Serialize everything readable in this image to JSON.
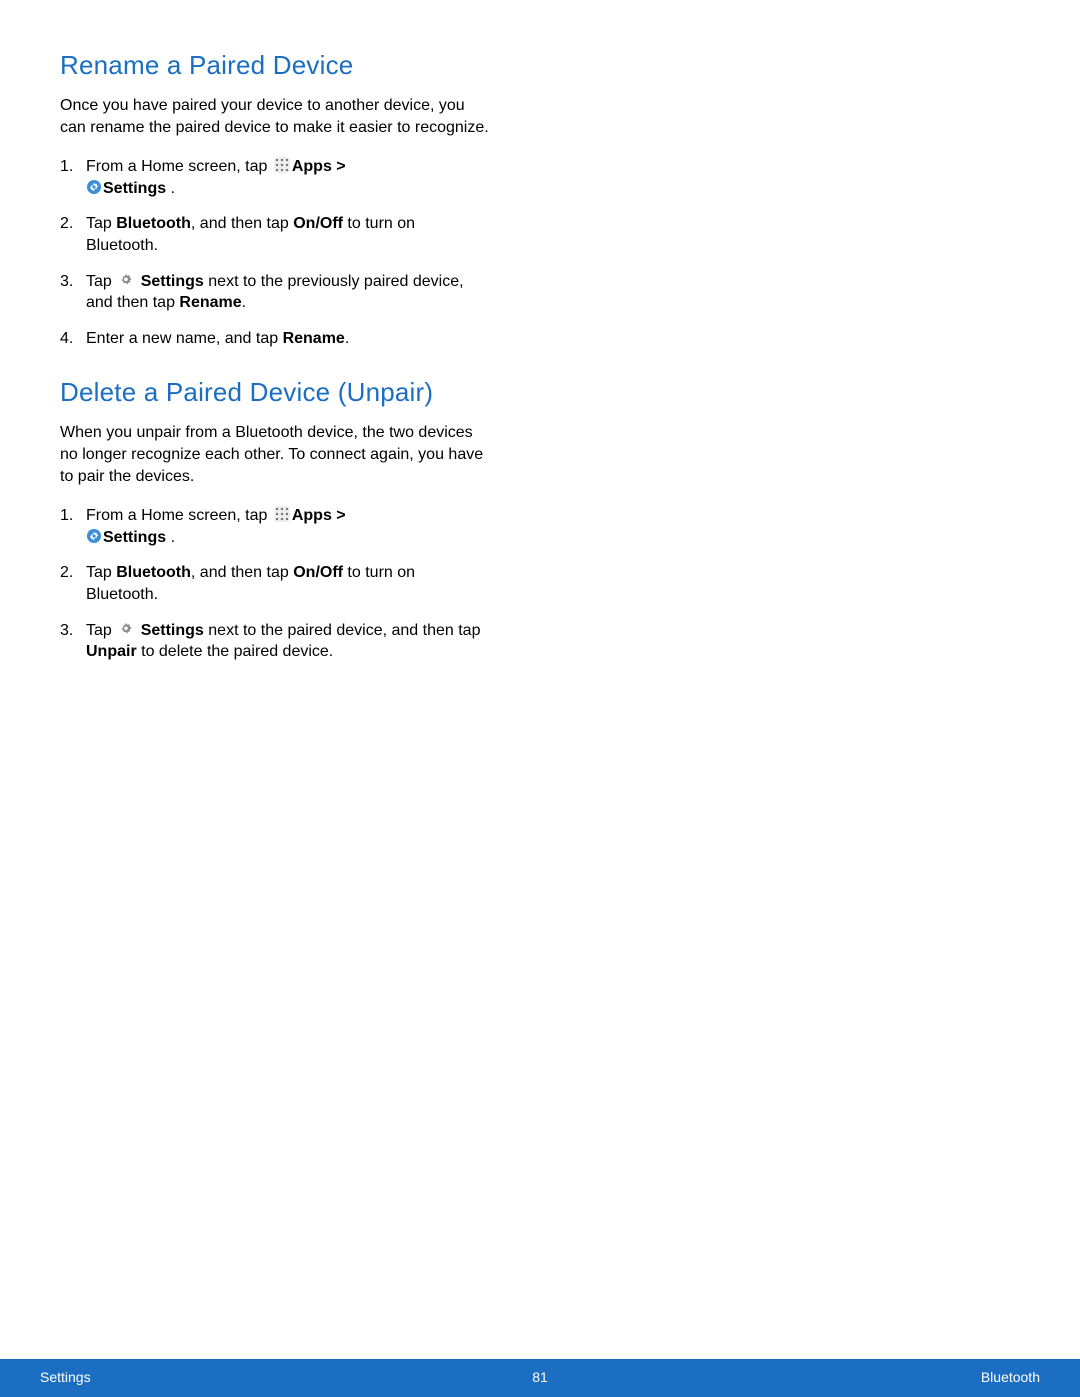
{
  "section1": {
    "heading": "Rename a Paired Device",
    "intro": "Once you have paired your device to another device, you can rename the paired device to make it easier to recognize.",
    "step1_a": "From a Home screen, tap ",
    "step1_apps": "Apps",
    "step1_gt": " > ",
    "step1_settings": "Settings",
    "step1_period": " .",
    "step2_a": "Tap ",
    "step2_bt": "Bluetooth",
    "step2_b": ", and then tap ",
    "step2_onoff": "On/Off",
    "step2_c": " to turn on Bluetooth.",
    "step3_a": "Tap ",
    "step3_settings": "Settings",
    "step3_b": " next to the previously paired device, and then tap ",
    "step3_rename": "Rename",
    "step3_c": ".",
    "step4_a": "Enter a new name, and tap ",
    "step4_rename": "Rename",
    "step4_b": "."
  },
  "section2": {
    "heading": "Delete a Paired Device (Unpair)",
    "intro": "When you unpair from a Bluetooth device, the two devices no longer recognize each other. To connect again, you have to pair the devices.",
    "step1_a": "From a Home screen, tap ",
    "step1_apps": "Apps",
    "step1_gt": " > ",
    "step1_settings": "Settings",
    "step1_period": " .",
    "step2_a": "Tap ",
    "step2_bt": "Bluetooth",
    "step2_b": ", and then tap ",
    "step2_onoff": "On/Off",
    "step2_c": " to turn on Bluetooth.",
    "step3_a": "Tap ",
    "step3_settings": "Settings",
    "step3_b": " next to the paired device, and then tap ",
    "step3_unpair": "Unpair",
    "step3_c": " to delete the paired device."
  },
  "footer": {
    "left": "Settings",
    "center": "81",
    "right": "Bluetooth"
  }
}
